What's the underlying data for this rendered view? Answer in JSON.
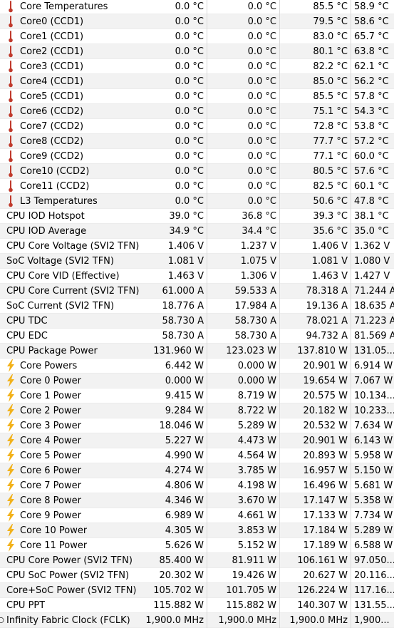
{
  "colors": {
    "row_alt": "#f2f2f2",
    "thermometer": "#c0392b",
    "bolt": "#f2b21b",
    "clock_circle": "#3b3b3b"
  },
  "rows": [
    {
      "indent": true,
      "icon": "thermometer-icon",
      "name": "Core Temperatures",
      "current": "0.0 °C",
      "min": "0.0 °C",
      "max": "85.5 °C",
      "avg": "58.9 °C"
    },
    {
      "indent": true,
      "icon": "thermometer-icon",
      "name": "Core0 (CCD1)",
      "current": "0.0 °C",
      "min": "0.0 °C",
      "max": "79.5 °C",
      "avg": "58.6 °C"
    },
    {
      "indent": true,
      "icon": "thermometer-icon",
      "name": "Core1 (CCD1)",
      "current": "0.0 °C",
      "min": "0.0 °C",
      "max": "83.0 °C",
      "avg": "65.7 °C"
    },
    {
      "indent": true,
      "icon": "thermometer-icon",
      "name": "Core2 (CCD1)",
      "current": "0.0 °C",
      "min": "0.0 °C",
      "max": "80.1 °C",
      "avg": "63.8 °C"
    },
    {
      "indent": true,
      "icon": "thermometer-icon",
      "name": "Core3 (CCD1)",
      "current": "0.0 °C",
      "min": "0.0 °C",
      "max": "82.2 °C",
      "avg": "62.1 °C"
    },
    {
      "indent": true,
      "icon": "thermometer-icon",
      "name": "Core4 (CCD1)",
      "current": "0.0 °C",
      "min": "0.0 °C",
      "max": "85.0 °C",
      "avg": "56.2 °C"
    },
    {
      "indent": true,
      "icon": "thermometer-icon",
      "name": "Core5 (CCD1)",
      "current": "0.0 °C",
      "min": "0.0 °C",
      "max": "85.5 °C",
      "avg": "57.8 °C"
    },
    {
      "indent": true,
      "icon": "thermometer-icon",
      "name": "Core6 (CCD2)",
      "current": "0.0 °C",
      "min": "0.0 °C",
      "max": "75.1 °C",
      "avg": "54.3 °C"
    },
    {
      "indent": true,
      "icon": "thermometer-icon",
      "name": "Core7 (CCD2)",
      "current": "0.0 °C",
      "min": "0.0 °C",
      "max": "72.8 °C",
      "avg": "53.8 °C"
    },
    {
      "indent": true,
      "icon": "thermometer-icon",
      "name": "Core8 (CCD2)",
      "current": "0.0 °C",
      "min": "0.0 °C",
      "max": "77.7 °C",
      "avg": "57.2 °C"
    },
    {
      "indent": true,
      "icon": "thermometer-icon",
      "name": "Core9 (CCD2)",
      "current": "0.0 °C",
      "min": "0.0 °C",
      "max": "77.1 °C",
      "avg": "60.0 °C"
    },
    {
      "indent": true,
      "icon": "thermometer-icon",
      "name": "Core10 (CCD2)",
      "current": "0.0 °C",
      "min": "0.0 °C",
      "max": "80.5 °C",
      "avg": "57.6 °C"
    },
    {
      "indent": true,
      "icon": "thermometer-icon",
      "name": "Core11 (CCD2)",
      "current": "0.0 °C",
      "min": "0.0 °C",
      "max": "82.5 °C",
      "avg": "60.1 °C"
    },
    {
      "indent": true,
      "icon": "thermometer-icon",
      "name": "L3 Temperatures",
      "current": "0.0 °C",
      "min": "0.0 °C",
      "max": "50.6 °C",
      "avg": "47.8 °C"
    },
    {
      "indent": false,
      "icon": "",
      "name": "CPU IOD Hotspot",
      "current": "39.0 °C",
      "min": "36.8 °C",
      "max": "39.3 °C",
      "avg": "38.1 °C"
    },
    {
      "indent": false,
      "icon": "",
      "name": "CPU IOD Average",
      "current": "34.9 °C",
      "min": "34.4 °C",
      "max": "35.6 °C",
      "avg": "35.0 °C"
    },
    {
      "indent": false,
      "icon": "",
      "name": "CPU Core Voltage (SVI2 TFN)",
      "current": "1.406 V",
      "min": "1.237 V",
      "max": "1.406 V",
      "avg": "1.362 V"
    },
    {
      "indent": false,
      "icon": "",
      "name": "SoC Voltage (SVI2 TFN)",
      "current": "1.081 V",
      "min": "1.075 V",
      "max": "1.081 V",
      "avg": "1.080 V"
    },
    {
      "indent": false,
      "icon": "",
      "name": "CPU Core VID (Effective)",
      "current": "1.463 V",
      "min": "1.306 V",
      "max": "1.463 V",
      "avg": "1.427 V"
    },
    {
      "indent": false,
      "icon": "",
      "name": "CPU Core Current (SVI2 TFN)",
      "current": "61.000 A",
      "min": "59.533 A",
      "max": "78.318 A",
      "avg": "71.244 A"
    },
    {
      "indent": false,
      "icon": "",
      "name": "SoC Current (SVI2 TFN)",
      "current": "18.776 A",
      "min": "17.984 A",
      "max": "19.136 A",
      "avg": "18.635 A"
    },
    {
      "indent": false,
      "icon": "",
      "name": "CPU TDC",
      "current": "58.730 A",
      "min": "58.730 A",
      "max": "78.021 A",
      "avg": "71.223 A"
    },
    {
      "indent": false,
      "icon": "",
      "name": "CPU EDC",
      "current": "58.730 A",
      "min": "58.730 A",
      "max": "94.732 A",
      "avg": "81.569 A"
    },
    {
      "indent": false,
      "icon": "",
      "name": "CPU Package Power",
      "current": "131.960 W",
      "min": "123.023 W",
      "max": "137.810 W",
      "avg": "131.05..."
    },
    {
      "indent": true,
      "icon": "bolt-icon",
      "name": "Core Powers",
      "current": "6.442 W",
      "min": "0.000 W",
      "max": "20.901 W",
      "avg": "6.914 W"
    },
    {
      "indent": true,
      "icon": "bolt-icon",
      "name": "Core 0 Power",
      "current": "0.000 W",
      "min": "0.000 W",
      "max": "19.654 W",
      "avg": "7.067 W"
    },
    {
      "indent": true,
      "icon": "bolt-icon",
      "name": "Core 1 Power",
      "current": "9.415 W",
      "min": "8.719 W",
      "max": "20.575 W",
      "avg": "10.134..."
    },
    {
      "indent": true,
      "icon": "bolt-icon",
      "name": "Core 2 Power",
      "current": "9.284 W",
      "min": "8.722 W",
      "max": "20.182 W",
      "avg": "10.233..."
    },
    {
      "indent": true,
      "icon": "bolt-icon",
      "name": "Core 3 Power",
      "current": "18.046 W",
      "min": "5.289 W",
      "max": "20.532 W",
      "avg": "7.634 W"
    },
    {
      "indent": true,
      "icon": "bolt-icon",
      "name": "Core 4 Power",
      "current": "5.227 W",
      "min": "4.473 W",
      "max": "20.901 W",
      "avg": "6.143 W"
    },
    {
      "indent": true,
      "icon": "bolt-icon",
      "name": "Core 5 Power",
      "current": "4.990 W",
      "min": "4.564 W",
      "max": "20.893 W",
      "avg": "5.958 W"
    },
    {
      "indent": true,
      "icon": "bolt-icon",
      "name": "Core 6 Power",
      "current": "4.274 W",
      "min": "3.785 W",
      "max": "16.957 W",
      "avg": "5.150 W"
    },
    {
      "indent": true,
      "icon": "bolt-icon",
      "name": "Core 7 Power",
      "current": "4.806 W",
      "min": "4.198 W",
      "max": "16.496 W",
      "avg": "5.681 W"
    },
    {
      "indent": true,
      "icon": "bolt-icon",
      "name": "Core 8 Power",
      "current": "4.346 W",
      "min": "3.670 W",
      "max": "17.147 W",
      "avg": "5.358 W"
    },
    {
      "indent": true,
      "icon": "bolt-icon",
      "name": "Core 9 Power",
      "current": "6.989 W",
      "min": "4.661 W",
      "max": "17.133 W",
      "avg": "7.734 W"
    },
    {
      "indent": true,
      "icon": "bolt-icon",
      "name": "Core 10 Power",
      "current": "4.305 W",
      "min": "3.853 W",
      "max": "17.184 W",
      "avg": "5.289 W"
    },
    {
      "indent": true,
      "icon": "bolt-icon",
      "name": "Core 11 Power",
      "current": "5.626 W",
      "min": "5.152 W",
      "max": "17.189 W",
      "avg": "6.588 W"
    },
    {
      "indent": false,
      "icon": "",
      "name": "CPU Core Power (SVI2 TFN)",
      "current": "85.400 W",
      "min": "81.911 W",
      "max": "106.161 W",
      "avg": "97.050..."
    },
    {
      "indent": false,
      "icon": "",
      "name": "CPU SoC Power (SVI2 TFN)",
      "current": "20.302 W",
      "min": "19.426 W",
      "max": "20.627 W",
      "avg": "20.116..."
    },
    {
      "indent": false,
      "icon": "",
      "name": "Core+SoC Power (SVI2 TFN)",
      "current": "105.702 W",
      "min": "101.705 W",
      "max": "126.224 W",
      "avg": "117.16..."
    },
    {
      "indent": false,
      "icon": "",
      "name": "CPU PPT",
      "current": "115.882 W",
      "min": "115.882 W",
      "max": "140.307 W",
      "avg": "131.55..."
    },
    {
      "indent": false,
      "icon": "clock-icon",
      "name": "Infinity Fabric Clock (FCLK)",
      "current": "1,900.0 MHz",
      "min": "1,900.0 MHz",
      "max": "1,900.0 MHz",
      "avg": "1,900..."
    }
  ]
}
